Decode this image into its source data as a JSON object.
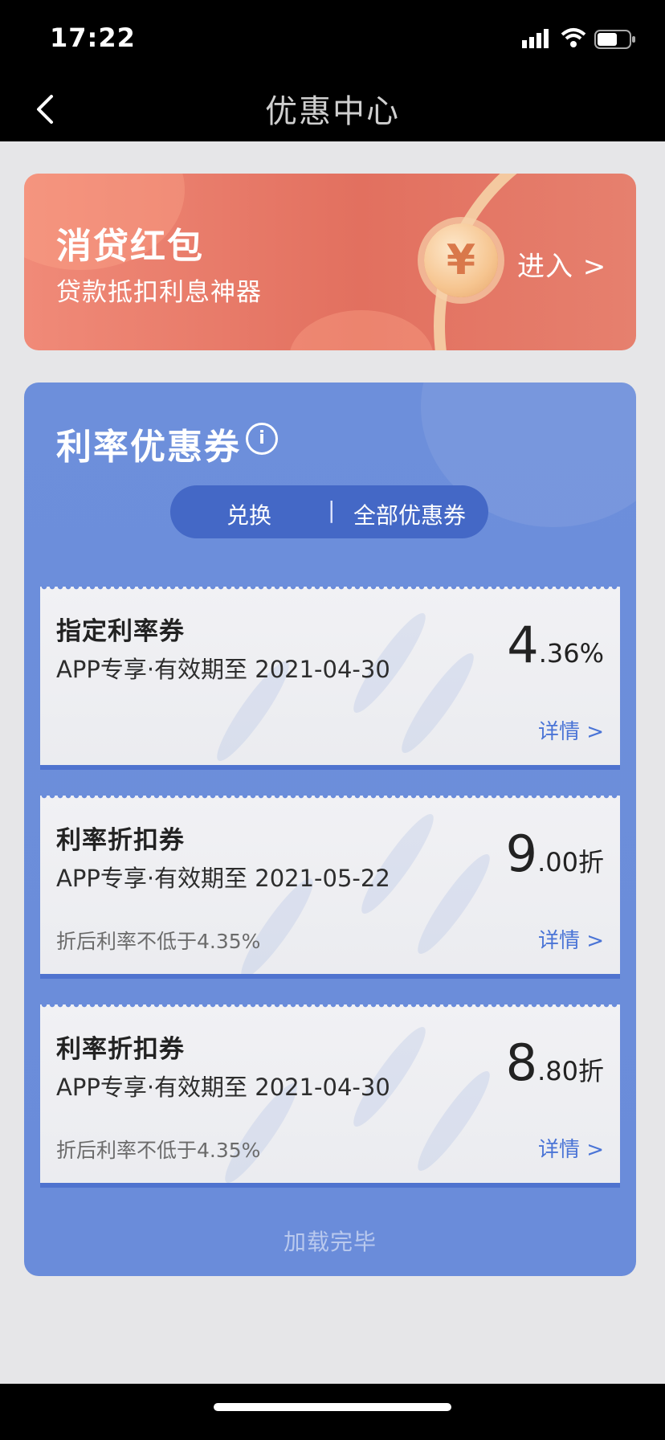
{
  "status": {
    "time": "17:22",
    "icons": [
      "cellular-signal-icon",
      "wifi-icon",
      "battery-icon"
    ]
  },
  "nav": {
    "back_icon": "chevron-left-icon",
    "title": "优惠中心"
  },
  "promo": {
    "title": "消贷红包",
    "subtitle": "贷款抵扣利息神器",
    "coin_symbol": "¥",
    "enter_label": "进入 >"
  },
  "coupons_panel": {
    "title": "利率优惠券",
    "info_icon": "info-icon",
    "info_glyph": "i",
    "tabs": {
      "exchange": "兑换",
      "separator": "|",
      "all": "全部优惠券"
    },
    "items": [
      {
        "name": "指定利率券",
        "validity": "APP专享·有效期至 2021-04-30",
        "value_big": "4",
        "value_small": ".36%",
        "note": "",
        "detail_label": "详情 >"
      },
      {
        "name": "利率折扣券",
        "validity": "APP专享·有效期至 2021-05-22",
        "value_big": "9",
        "value_small": ".00折",
        "note": "折后利率不低于4.35%",
        "detail_label": "详情 >"
      },
      {
        "name": "利率折扣券",
        "validity": "APP专享·有效期至 2021-04-30",
        "value_big": "8",
        "value_small": ".80折",
        "note": "折后利率不低于4.35%",
        "detail_label": "详情 >"
      }
    ],
    "load_done": "加载完毕"
  },
  "colors": {
    "promo_red": "#e2705f",
    "panel_blue": "#6a8cda",
    "tab_blue": "#4468c6",
    "link_blue": "#4a74d6"
  }
}
